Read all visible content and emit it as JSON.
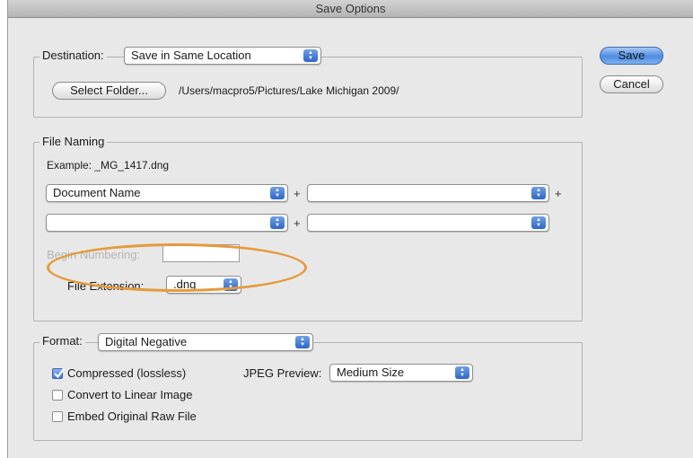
{
  "window": {
    "title": "Save Options"
  },
  "buttons": {
    "save": "Save",
    "cancel": "Cancel"
  },
  "destination": {
    "label": "Destination:",
    "value": "Save in Same Location",
    "select_folder": "Select Folder...",
    "path": "/Users/macpro5/Pictures/Lake Michigan 2009/"
  },
  "file_naming": {
    "legend": "File Naming",
    "example": "Example:  _MG_1417.dng",
    "field1": "Document Name",
    "field2": "",
    "field3": "",
    "field4": "",
    "plus": "+",
    "begin_numbering": "Begin Numbering:",
    "begin_numbering_value": "",
    "file_extension_label": "File Extension:",
    "file_extension_value": ".dng"
  },
  "format": {
    "label": "Format:",
    "value": "Digital Negative",
    "compressed": {
      "label": "Compressed (lossless)",
      "checked": true
    },
    "linear": {
      "label": "Convert to Linear Image",
      "checked": false
    },
    "embed": {
      "label": "Embed Original Raw File",
      "checked": false
    },
    "jpeg_preview_label": "JPEG Preview:",
    "jpeg_preview_value": "Medium Size"
  },
  "colors": {
    "accent": "#4f8ce0",
    "highlight": "#e59a3c"
  }
}
